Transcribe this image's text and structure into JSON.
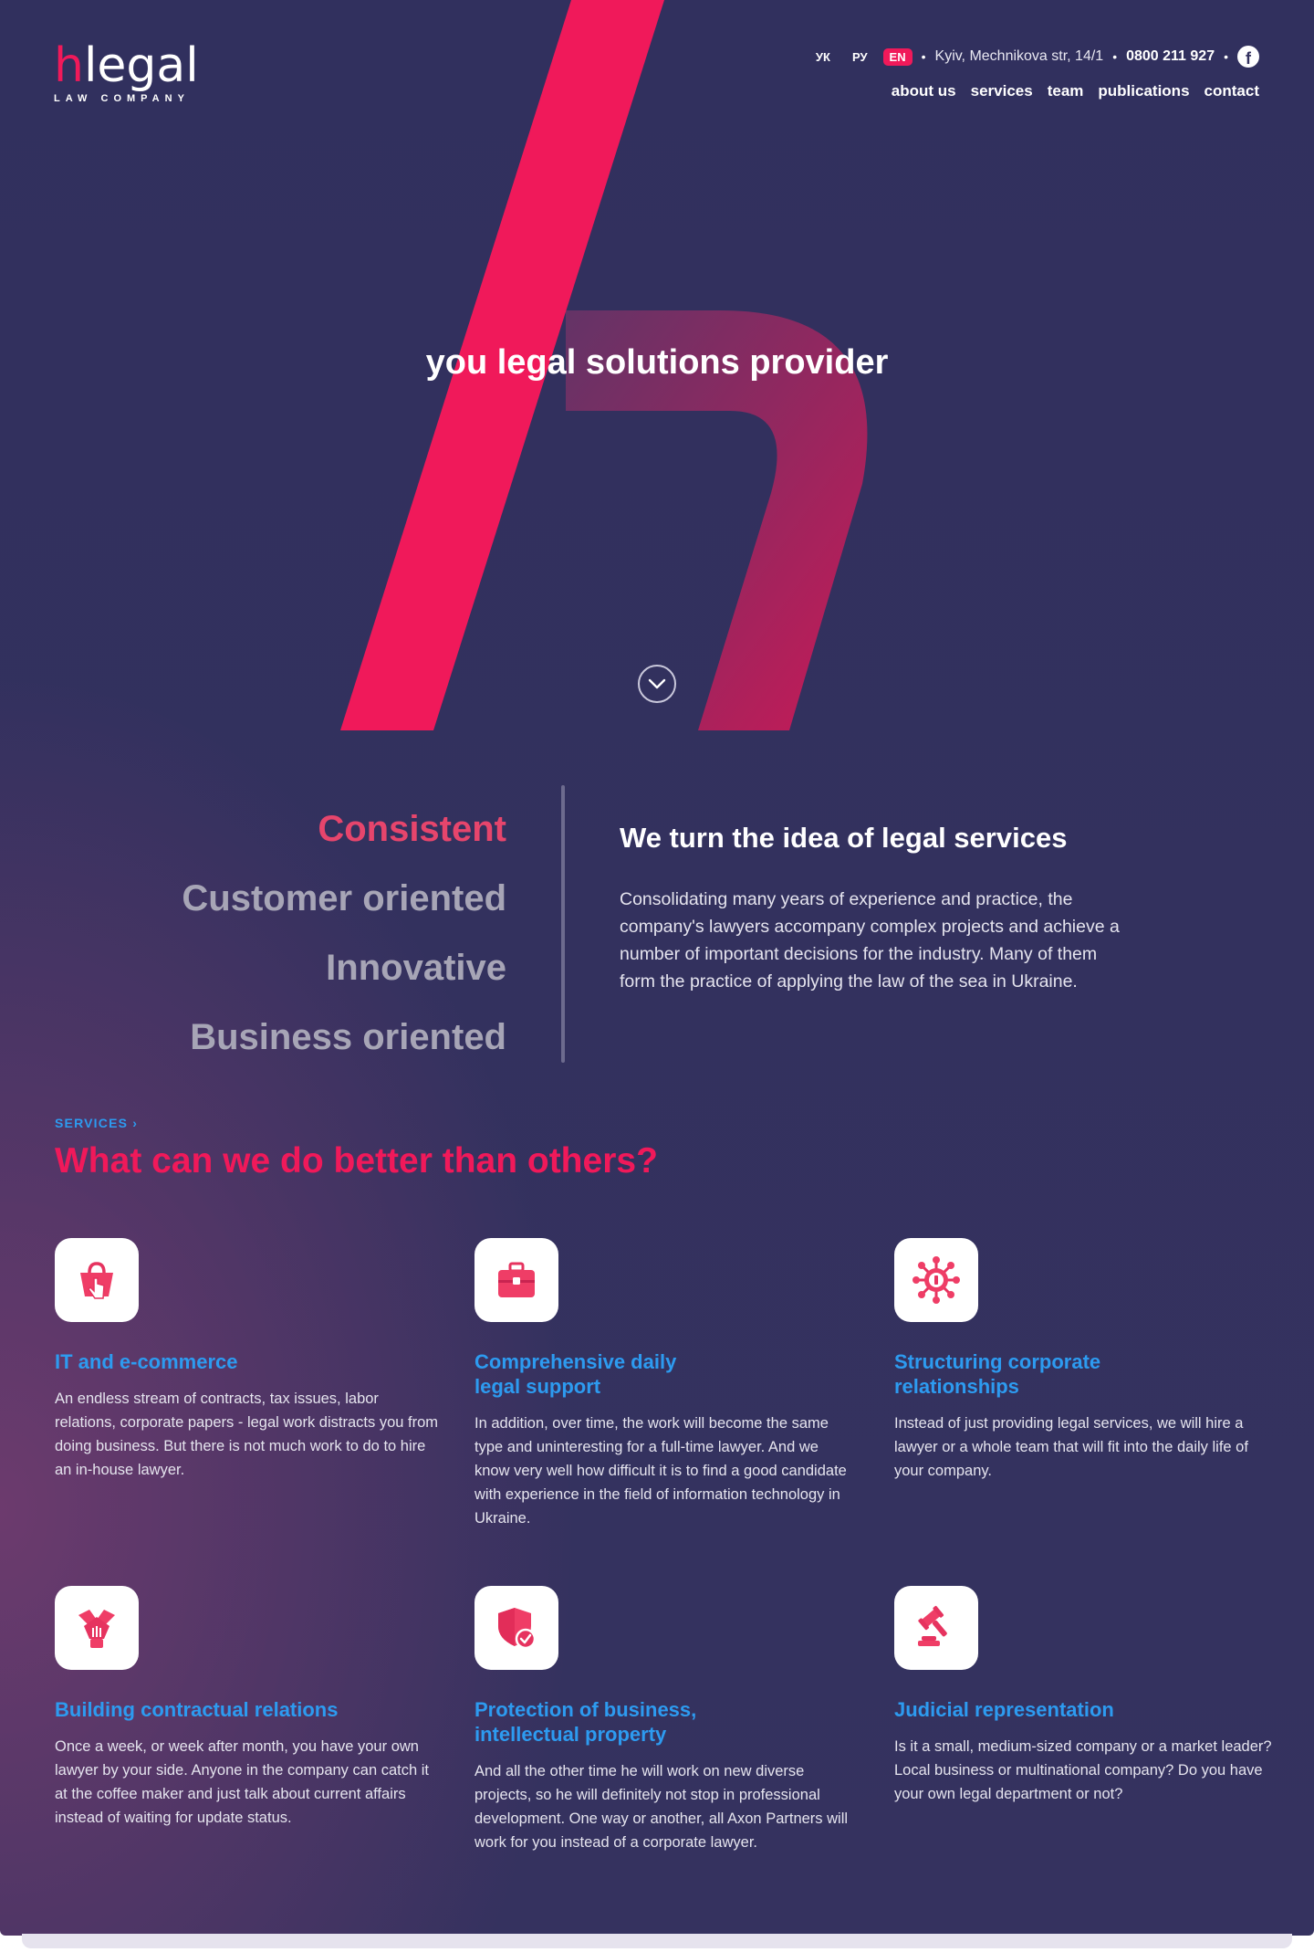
{
  "header": {
    "logo_letter": "h",
    "logo_rest": "legal",
    "logo_subtitle": "LAW COMPANY",
    "languages": [
      {
        "label": "УК",
        "active": false
      },
      {
        "label": "РУ",
        "active": false
      },
      {
        "label": "EN",
        "active": true
      }
    ],
    "address": "Kyiv, Mechnikova str, 14/1",
    "phone": "0800 211 927",
    "facebook_icon": "f",
    "nav": [
      "about us",
      "services",
      "team",
      "publications",
      "contact"
    ]
  },
  "hero": {
    "title": "you legal solutions provider",
    "scroll_icon": "chevron-down-icon"
  },
  "values": {
    "items": [
      "Consistent",
      "Customer oriented",
      "Innovative",
      "Business oriented"
    ],
    "active_index": 0
  },
  "about": {
    "title": "We turn the idea of legal services",
    "text": "Consolidating many years of experience and practice, the company's lawyers accompany complex projects and achieve a number of important decisions for the industry. Many of them form the practice of applying the law of the sea in Ukraine."
  },
  "services": {
    "kicker": "SERVICES",
    "heading": "What can we do better than others?",
    "cards": [
      {
        "icon": "shopping-basket-icon",
        "title": "IT and e-commerce",
        "text": "An endless stream of contracts, tax issues, labor relations, corporate papers - legal work distracts you from doing business. But there is not much work to do to hire an in-house lawyer."
      },
      {
        "icon": "briefcase-icon",
        "title": "Comprehensive daily legal support",
        "text": "In addition, over time, the work will become the same type and uninteresting for a full-time lawyer. And we know very well how difficult it is to find a good candidate with experience in the field of information technology in Ukraine."
      },
      {
        "icon": "network-icon",
        "title": "Structuring corporate relationships",
        "text": "Instead of just providing legal services, we will hire a lawyer or a whole team that will fit into the daily life of your company."
      },
      {
        "icon": "hands-together-icon",
        "title": "Building contractual relations",
        "text": "Once a week, or week after month, you have your own lawyer by your side. Anyone in the company can catch it at the coffee maker and just talk about current affairs instead of waiting for update status."
      },
      {
        "icon": "shield-check-icon",
        "title": "Protection of business, intellectual property",
        "text": "And all the other time he will work on new diverse projects, so he will definitely not stop in professional development. One way or another, all Axon Partners will work for you instead of a corporate lawyer."
      },
      {
        "icon": "gavel-icon",
        "title": "Judicial representation",
        "text": "Is it a small, medium-sized company or a market leader? Local business or multinational company? Do you have your own legal department or not?"
      }
    ]
  },
  "colors": {
    "background": "#33315f",
    "accent": "#f0195a",
    "link_blue": "#2d9bf0",
    "muted_text": "#a7a5b6"
  }
}
